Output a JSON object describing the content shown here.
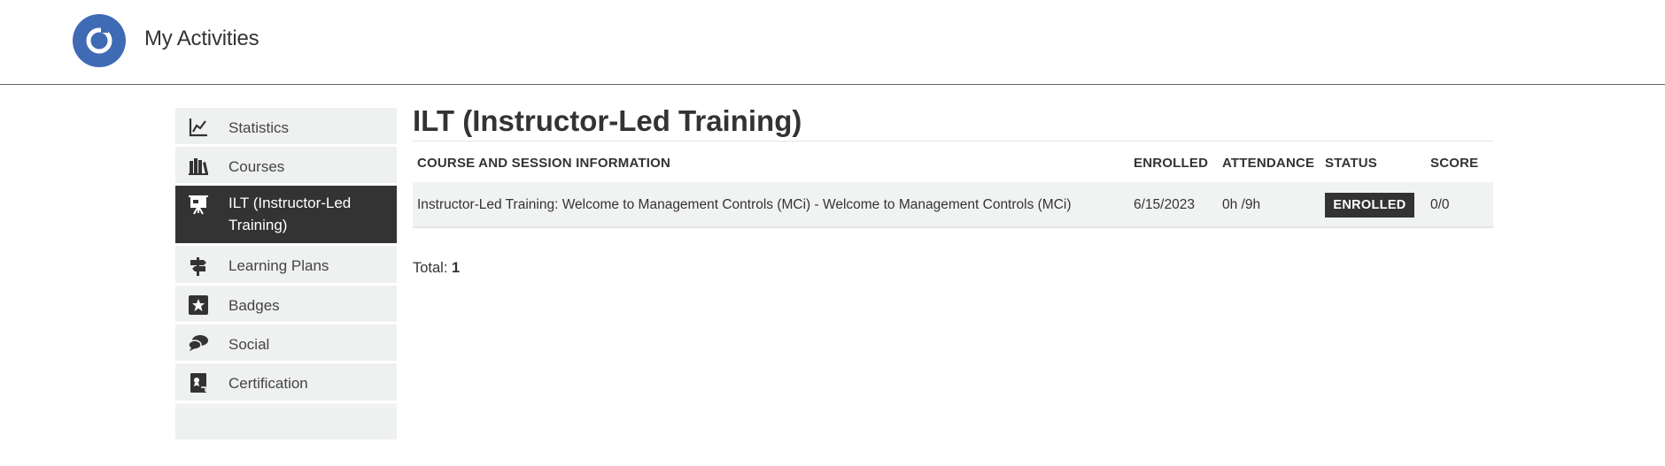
{
  "header": {
    "title": "My Activities",
    "logo_icon": "circle-logo-icon",
    "brand_color": "#3f6bb5"
  },
  "sidebar": {
    "items": [
      {
        "label": "Statistics",
        "icon": "line-chart-icon",
        "active": false
      },
      {
        "label": "Courses",
        "icon": "books-icon",
        "active": false
      },
      {
        "label": "ILT (Instructor-Led Training)",
        "icon": "presentation-board-icon",
        "active": true
      },
      {
        "label": "Learning Plans",
        "icon": "signpost-icon",
        "active": false
      },
      {
        "label": "Badges",
        "icon": "star-badge-icon",
        "active": false
      },
      {
        "label": "Social",
        "icon": "chat-bubbles-icon",
        "active": false
      },
      {
        "label": "Certification",
        "icon": "certificate-icon",
        "active": false
      }
    ]
  },
  "main": {
    "title": "ILT (Instructor-Led Training)",
    "table": {
      "columns": [
        "COURSE AND SESSION INFORMATION",
        "ENROLLED",
        "ATTENDANCE",
        "STATUS",
        "SCORE"
      ],
      "rows": [
        {
          "course": "Instructor-Led Training: Welcome to Management Controls (MCi) - Welcome to Management Controls (MCi)",
          "enrolled": "6/15/2023",
          "attendance": "0h /9h",
          "status": "ENROLLED",
          "score": "0/0"
        }
      ]
    },
    "total_label": "Total:",
    "total_value": "1"
  },
  "colors": {
    "active_bg": "#333333",
    "sidebar_bg": "#eff1f0",
    "status_badge_bg": "#333333"
  }
}
